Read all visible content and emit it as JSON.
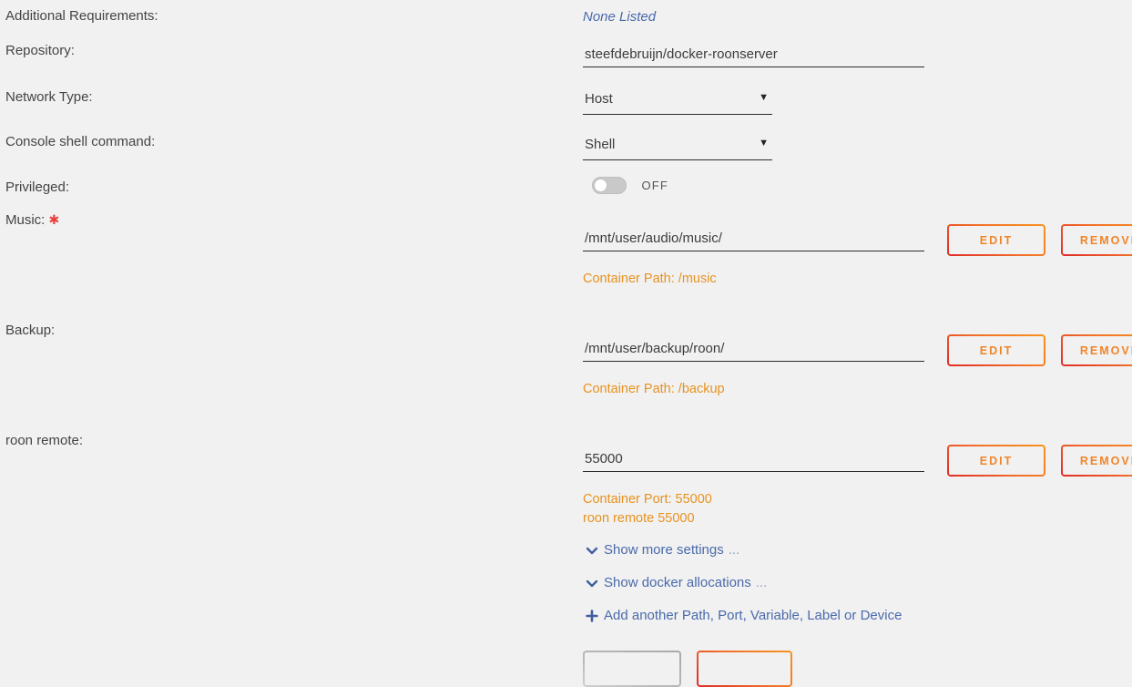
{
  "background": "#f1f1f1",
  "colors": {
    "label": "#444444",
    "link_blue": "#4a6aab",
    "hint_orange": "#e8921f",
    "accent_orange": "#f0852a",
    "accent_red": "#e02b28",
    "required_red": "#e8403a"
  },
  "rows": [
    {
      "label": "Additional Requirements:",
      "value": "None Listed"
    },
    {
      "label": "Repository:",
      "value": "steefdebruijn/docker-roonserver"
    },
    {
      "label": "Network Type:",
      "value": "Host"
    },
    {
      "label": "Console shell command:",
      "value": "Shell"
    },
    {
      "label": "Privileged:",
      "value": "OFF"
    },
    {
      "label": "Music:",
      "required": true,
      "value": "/mnt/user/audio/music/",
      "hint": "Container Path: /music"
    },
    {
      "label": "Backup:",
      "value": "/mnt/user/backup/roon/",
      "hint": "Container Path: /backup"
    },
    {
      "label": "roon remote:",
      "value": "55000",
      "hint": "Container Port: 55000",
      "hint2": "roon remote 55000"
    }
  ],
  "toggle": {
    "state_label": "OFF",
    "checked": false
  },
  "select_caret": "▼",
  "row_buttons": {
    "edit_label": "EDIT",
    "remove_label": "REMOVE"
  },
  "links": [
    {
      "icon": "chevron-down-icon",
      "glyph": "⌄",
      "text": "Show more settings",
      "ellipsis": "..."
    },
    {
      "icon": "chevron-down-icon",
      "glyph": "⌄",
      "text": "Show docker allocations",
      "ellipsis": "..."
    },
    {
      "icon": "plus-icon",
      "glyph": "✚",
      "text": "Add another Path, Port, Variable, Label or Device",
      "ellipsis": ""
    }
  ],
  "footer_buttons": {
    "cancel_label": "",
    "apply_label": ""
  }
}
